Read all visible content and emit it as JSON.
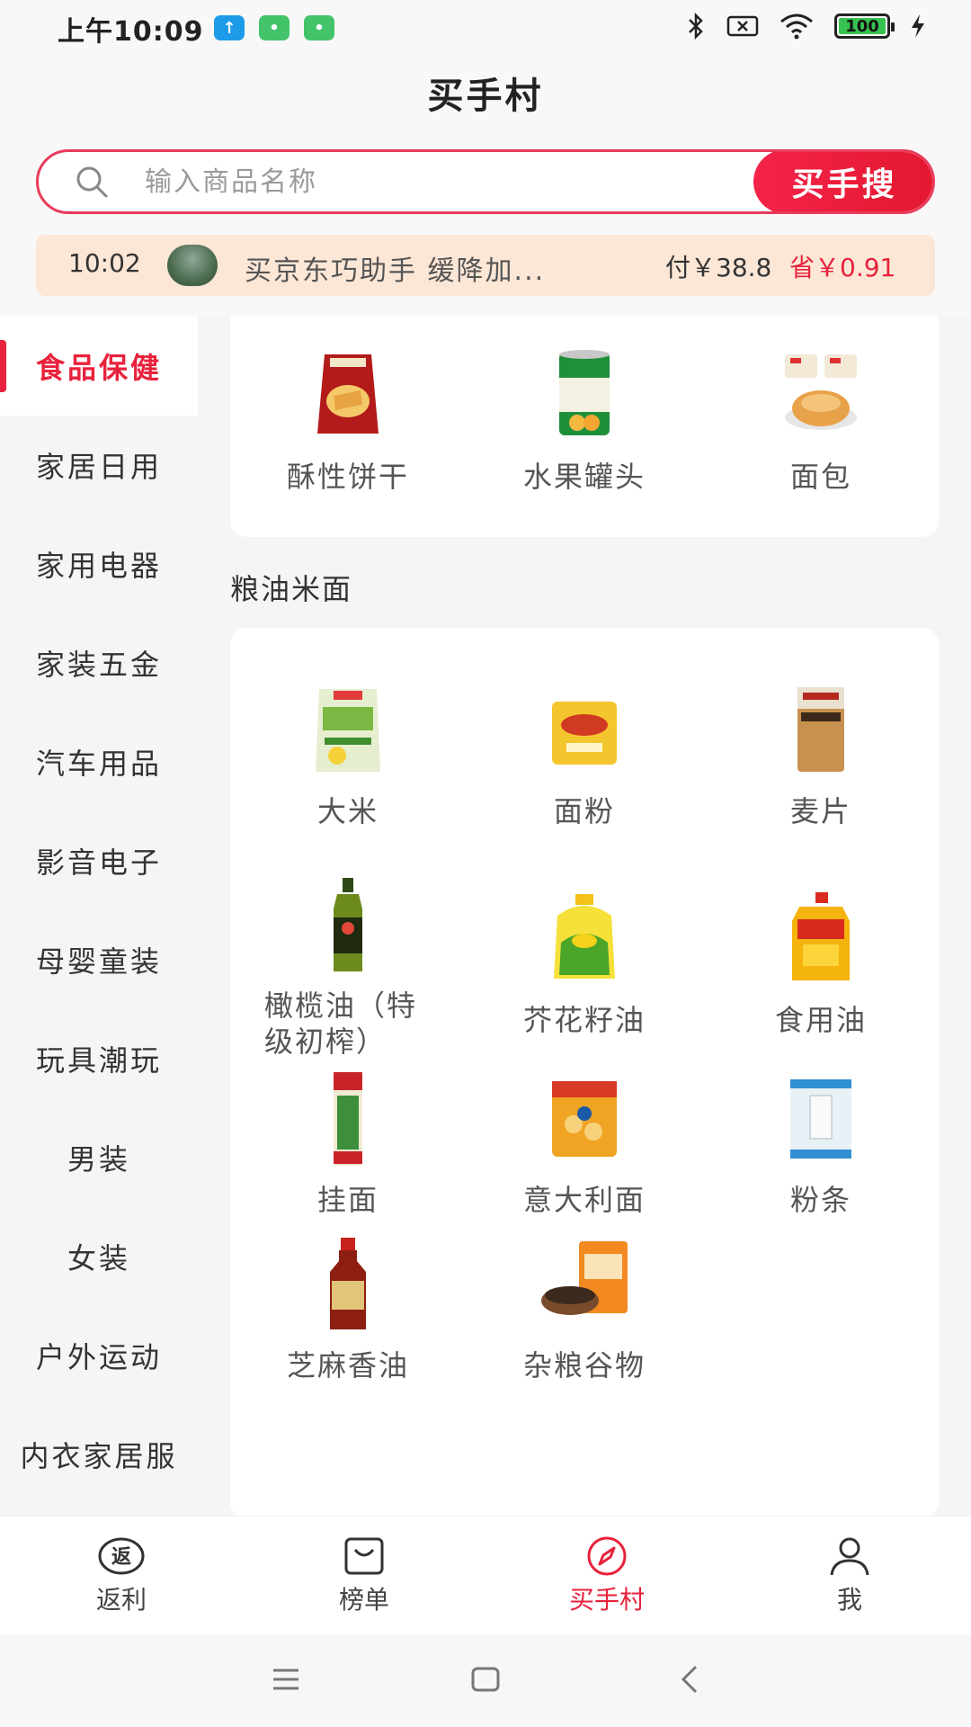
{
  "status_bar": {
    "time": "上午10:09",
    "battery": "100",
    "icons": [
      "upload-notification-icon",
      "app-notification-icon",
      "app-notification-icon",
      "bluetooth-icon",
      "no-sim-icon",
      "wifi-icon",
      "battery-icon",
      "charging-icon"
    ]
  },
  "header": {
    "title": "买手村"
  },
  "search": {
    "placeholder": "输入商品名称",
    "value": "",
    "button_label": "买手搜"
  },
  "ticker": {
    "time": "10:02",
    "text": "买京东巧助手 缓降加...",
    "paid": "付￥38.8",
    "saved": "省￥0.91"
  },
  "sidebar": {
    "active_index": 0,
    "items": [
      {
        "label": "食品保健"
      },
      {
        "label": "家居日用"
      },
      {
        "label": "家用电器"
      },
      {
        "label": "家装五金"
      },
      {
        "label": "汽车用品"
      },
      {
        "label": "影音电子"
      },
      {
        "label": "母婴童装"
      },
      {
        "label": "玩具潮玩"
      },
      {
        "label": "男装"
      },
      {
        "label": "女装"
      },
      {
        "label": "户外运动"
      },
      {
        "label": "内衣家居服"
      }
    ]
  },
  "top_products": [
    {
      "label": "酥性饼干"
    },
    {
      "label": "水果罐头"
    },
    {
      "label": "面包"
    }
  ],
  "section": {
    "title": "粮油米面",
    "products": [
      {
        "label": "大米"
      },
      {
        "label": "面粉"
      },
      {
        "label": "麦片"
      },
      {
        "label": "橄榄油（特级初榨）",
        "line1": "橄榄油（特",
        "line2": "级初榨）"
      },
      {
        "label": "芥花籽油"
      },
      {
        "label": "食用油"
      },
      {
        "label": "挂面"
      },
      {
        "label": "意大利面"
      },
      {
        "label": "粉条"
      },
      {
        "label": "芝麻香油"
      },
      {
        "label": "杂粮谷物"
      }
    ]
  },
  "bottom_nav": {
    "active_index": 2,
    "tabs": [
      {
        "label": "返利",
        "icon": "rebate-icon"
      },
      {
        "label": "榜单",
        "icon": "bag-icon"
      },
      {
        "label": "买手村",
        "icon": "compass-icon"
      },
      {
        "label": "我",
        "icon": "user-icon"
      }
    ]
  },
  "colors": {
    "accent": "#e8223c",
    "ticker_bg": "#fce6d6",
    "sidebar_bg": "#f5f5f5"
  }
}
